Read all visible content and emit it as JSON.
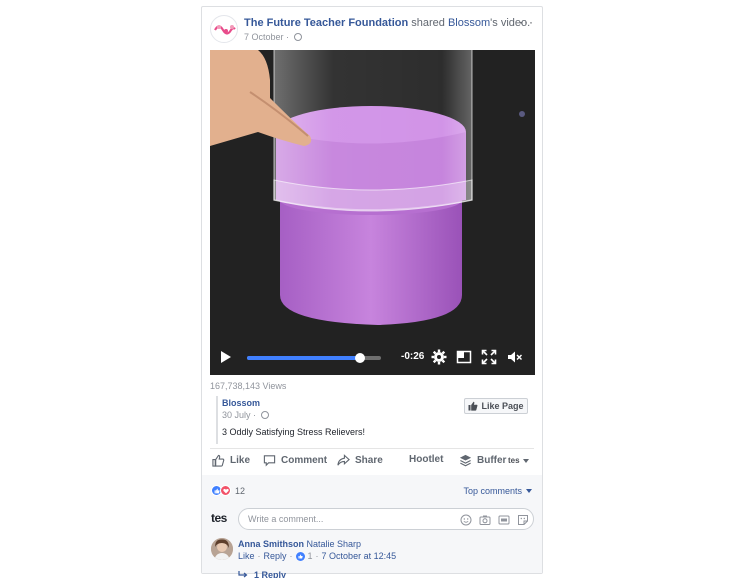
{
  "colors": {
    "link": "#365899",
    "muted": "#90949c",
    "accent": "#4080ff",
    "video_product": "#b978d3"
  },
  "post": {
    "page_name": "The Future Teacher Foundation",
    "shared_text": "shared",
    "source_name": "Blossom",
    "possessive_text": "'s video.",
    "date": "7 October",
    "privacy_icon": "globe-icon",
    "more_icon": "more-icon",
    "more_label": "···"
  },
  "video": {
    "time_remaining": "-0:26",
    "progress": 0.84,
    "controls": [
      "play-icon",
      "settings-gear-icon",
      "pip-icon",
      "fullscreen-icon",
      "mute-icon"
    ]
  },
  "views": "167,738,143 Views",
  "source": {
    "name": "Blossom",
    "date": "30 July",
    "like_page_label": "Like Page",
    "description": "3 Oddly Satisfying Stress Relievers!"
  },
  "actions": {
    "like": "Like",
    "comment": "Comment",
    "share": "Share",
    "hootlet": "Hootlet",
    "buffer": "Buffer",
    "account": "tes"
  },
  "reactions": {
    "count": "12",
    "types": [
      "like",
      "love"
    ]
  },
  "comments": {
    "sort_label": "Top comments",
    "commenter_logo": "tes",
    "input_placeholder": "Write a comment...",
    "input_icons": [
      "emoji-icon",
      "camera-icon",
      "gif-icon",
      "sticker-icon"
    ],
    "items": [
      {
        "author": "Anna Smithson",
        "text": "Natalie Sharp",
        "like": "Like",
        "reply": "Reply",
        "likes": "1",
        "time": "7 October at 12:45",
        "replies": "1 Reply"
      }
    ]
  }
}
